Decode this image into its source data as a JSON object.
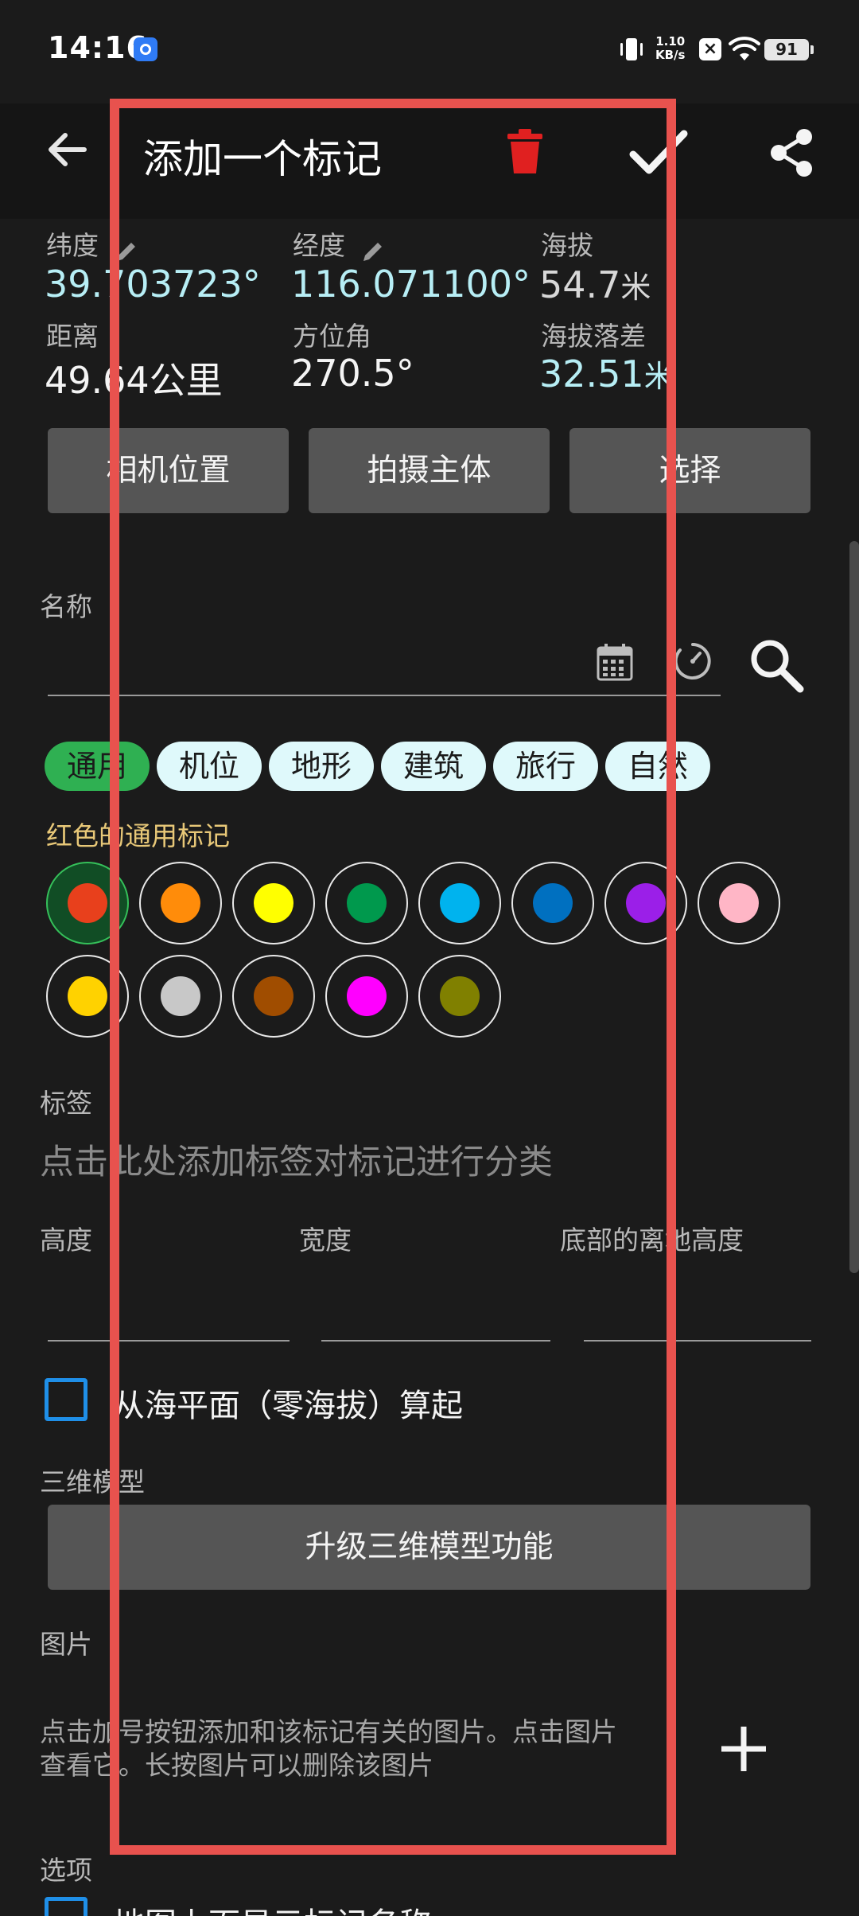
{
  "status": {
    "time": "14:16",
    "speed_line1": "1.10",
    "speed_line2": "KB/s",
    "battery": "91"
  },
  "appbar": {
    "title": "添加一个标记"
  },
  "coords": {
    "lat_label": "纬度",
    "lat_value": "39.703723°",
    "lon_label": "经度",
    "lon_value": "116.071100°",
    "alt_label": "海拔",
    "alt_value": "54.7",
    "alt_unit": "米",
    "dist_label": "距离",
    "dist_value": "49.64公里",
    "azimuth_label": "方位角",
    "azimuth_value": "270.5°",
    "altdiff_label": "海拔落差",
    "altdiff_value": "32.51",
    "altdiff_unit": "米"
  },
  "actions": {
    "camera_position": "相机位置",
    "subject": "拍摄主体",
    "select": "选择"
  },
  "name": {
    "label": "名称",
    "value": ""
  },
  "categories": [
    "通用",
    "机位",
    "地形",
    "建筑",
    "旅行",
    "自然"
  ],
  "selected_category": "通用",
  "color_caption": "红色的通用标记",
  "colors": [
    {
      "name": "red",
      "hex": "#e8401c",
      "selected": true
    },
    {
      "name": "orange",
      "hex": "#ff8c0a",
      "selected": false
    },
    {
      "name": "yellow",
      "hex": "#ffff00",
      "selected": false
    },
    {
      "name": "green",
      "hex": "#00994d",
      "selected": false
    },
    {
      "name": "sky-blue",
      "hex": "#00b3ee",
      "selected": false
    },
    {
      "name": "blue",
      "hex": "#0070c0",
      "selected": false
    },
    {
      "name": "purple",
      "hex": "#9b1fe8",
      "selected": false
    },
    {
      "name": "pink",
      "hex": "#ffb6c6",
      "selected": false
    },
    {
      "name": "gold",
      "hex": "#ffd200",
      "selected": false
    },
    {
      "name": "silver",
      "hex": "#c8c8c8",
      "selected": false
    },
    {
      "name": "brown",
      "hex": "#a04d00",
      "selected": false
    },
    {
      "name": "magenta",
      "hex": "#ff00ff",
      "selected": false
    },
    {
      "name": "olive",
      "hex": "#808000",
      "selected": false
    }
  ],
  "tags": {
    "label": "标签",
    "placeholder": "点击此处添加标签对标记进行分类"
  },
  "dimensions": {
    "height_label": "高度",
    "width_label": "宽度",
    "base_label": "底部的离地高度"
  },
  "sea_level_checkbox": "从海平面（零海拔）算起",
  "model": {
    "label": "三维模型",
    "upgrade_button": "升级三维模型功能"
  },
  "images": {
    "label": "图片",
    "hint_line1": "点击加号按钮添加和该标记有关的图片。点击图片",
    "hint_line2": "查看它。长按图片可以删除该图片"
  },
  "options": {
    "label": "选项",
    "show_name_partial": "地图上面显示标记名称"
  },
  "accent_colors": {
    "cyan_value": "#b7eef5",
    "highlight_box": "#e8524e",
    "caption_yellow": "#e8c878",
    "delete_red": "#e02020",
    "checkbox_blue": "#1f8fe8"
  }
}
